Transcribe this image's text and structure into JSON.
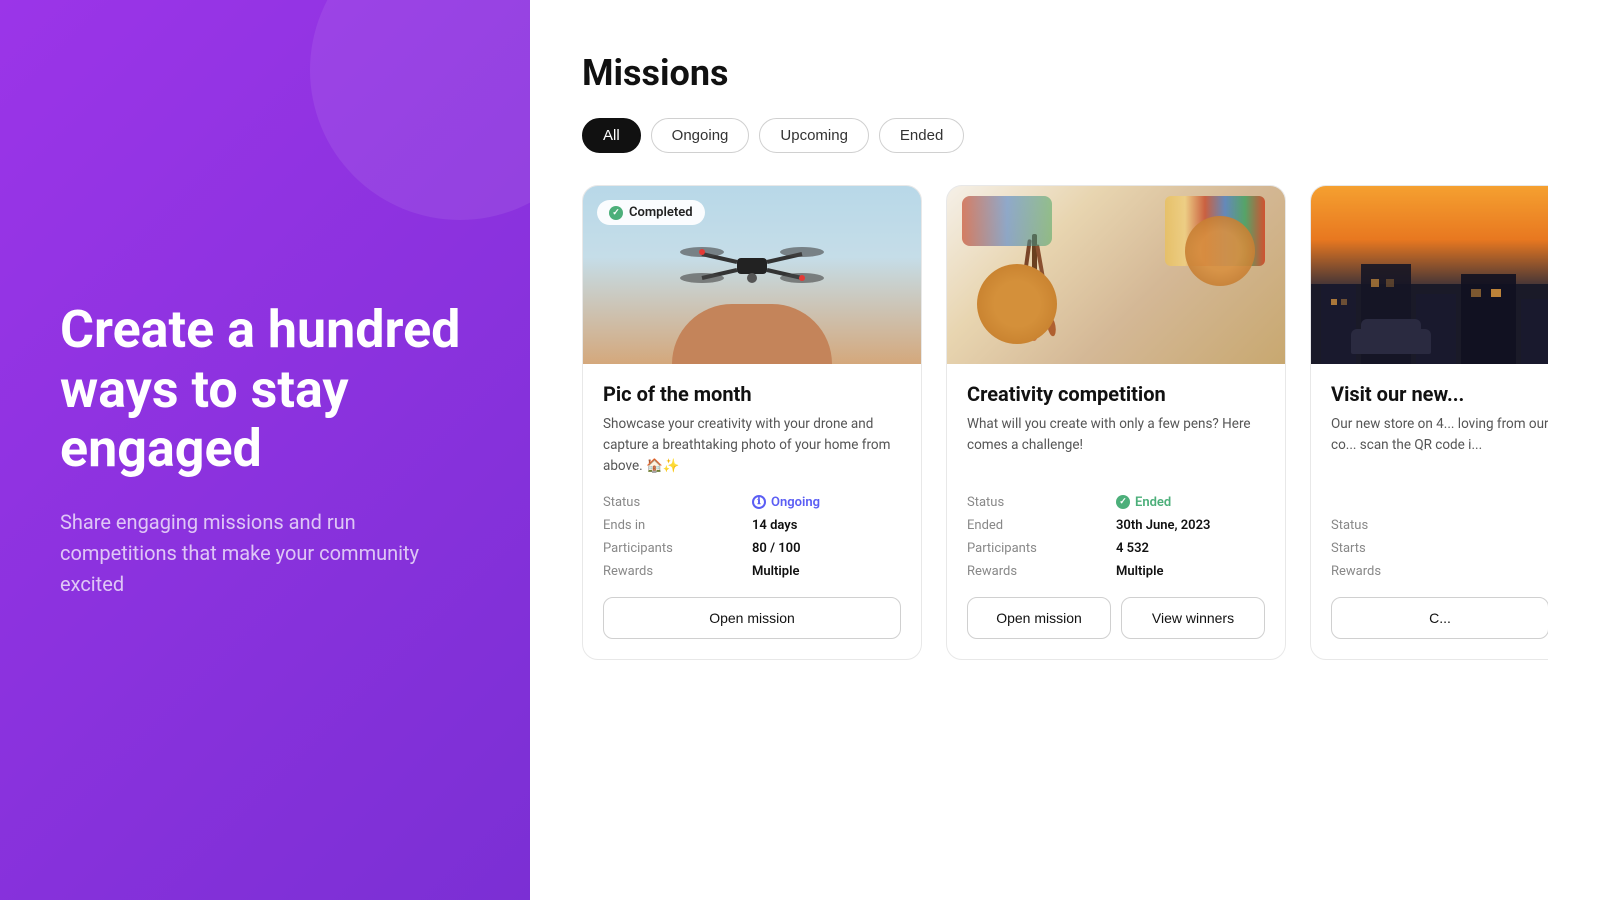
{
  "leftPanel": {
    "headline": "Create a hundred ways to stay engaged",
    "subtext": "Share engaging missions and run competitions that make your community excited"
  },
  "rightPanel": {
    "pageTitle": "Missions",
    "filters": [
      {
        "id": "all",
        "label": "All",
        "active": true
      },
      {
        "id": "ongoing",
        "label": "Ongoing",
        "active": false
      },
      {
        "id": "upcoming",
        "label": "Upcoming",
        "active": false
      },
      {
        "id": "ended",
        "label": "Ended",
        "active": false
      }
    ],
    "cards": [
      {
        "id": "pic-of-month",
        "badge": "Completed",
        "title": "Pic of the month",
        "description": "Showcase your creativity with your drone and capture a breathtaking photo of your home from above. 🏠✨",
        "meta": [
          {
            "label": "Status",
            "value": "Ongoing",
            "type": "ongoing"
          },
          {
            "label": "Ends in",
            "value": "14 days",
            "type": "plain"
          },
          {
            "label": "Participants",
            "value": "80 / 100",
            "type": "plain"
          },
          {
            "label": "Rewards",
            "value": "Multiple",
            "type": "plain"
          }
        ],
        "actions": [
          {
            "label": "Open mission",
            "type": "open"
          }
        ]
      },
      {
        "id": "creativity-competition",
        "badge": null,
        "title": "Creativity competition",
        "description": "What will you create with only a few pens? Here comes a challenge!",
        "meta": [
          {
            "label": "Status",
            "value": "Ended",
            "type": "ended"
          },
          {
            "label": "Ended",
            "value": "30th June, 2023",
            "type": "plain"
          },
          {
            "label": "Participants",
            "value": "4 532",
            "type": "plain"
          },
          {
            "label": "Rewards",
            "value": "Multiple",
            "type": "plain"
          }
        ],
        "actions": [
          {
            "label": "Open mission",
            "type": "open"
          },
          {
            "label": "View winners",
            "type": "winners"
          }
        ]
      },
      {
        "id": "visit-new-store",
        "badge": null,
        "title": "Visit our new...",
        "description": "Our new store on 4... loving from our co... scan the QR code i...",
        "meta": [
          {
            "label": "Status",
            "value": "",
            "type": "plain"
          },
          {
            "label": "Starts",
            "value": "...",
            "type": "plain"
          },
          {
            "label": "Rewards",
            "value": "...",
            "type": "plain"
          }
        ],
        "actions": [
          {
            "label": "C...",
            "type": "open"
          }
        ]
      }
    ]
  }
}
